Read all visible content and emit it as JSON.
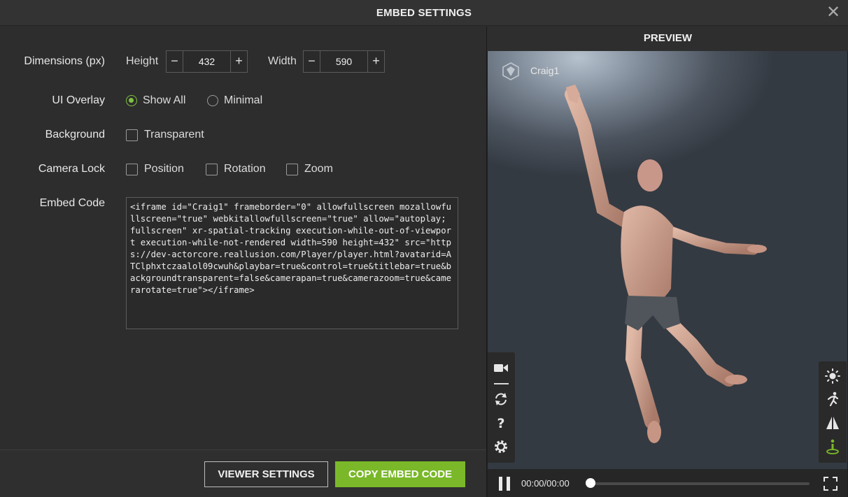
{
  "window": {
    "title": "EMBED SETTINGS",
    "close_glyph": "✕"
  },
  "form": {
    "dimensions": {
      "label": "Dimensions (px)",
      "height_label": "Height",
      "height_value": "432",
      "width_label": "Width",
      "width_value": "590",
      "minus": "−",
      "plus": "+"
    },
    "ui_overlay": {
      "label": "UI Overlay",
      "options": [
        "Show All",
        "Minimal"
      ],
      "selected": "Show All"
    },
    "background": {
      "label": "Background",
      "options": [
        "Transparent"
      ]
    },
    "camera_lock": {
      "label": "Camera Lock",
      "options": [
        "Position",
        "Rotation",
        "Zoom"
      ]
    },
    "embed_code": {
      "label": "Embed Code",
      "value": "<iframe id=\"Craig1\" frameborder=\"0\" allowfullscreen mozallowfullscreen=\"true\" webkitallowfullscreen=\"true\" allow=\"autoplay; fullscreen\" xr-spatial-tracking execution-while-out-of-viewport execution-while-not-rendered width=590 height=432\" src=\"https://dev-actorcore.reallusion.com/Player/player.html?avatarid=ATClphxtczaalol09cwuh&playbar=true&control=true&titlebar=true&backgroundtransparent=false&camerapan=true&camerazoom=true&camerarotate=true\"></iframe>"
    }
  },
  "buttons": {
    "viewer_settings": "VIEWER SETTINGS",
    "copy_embed_code": "COPY EMBED CODE"
  },
  "preview": {
    "title": "PREVIEW",
    "avatar_name": "Craig1",
    "left_tools": [
      "camera-icon",
      "rotate-icon",
      "help-icon",
      "settings-icon"
    ],
    "right_tools": [
      "light-icon",
      "motion-icon",
      "mirror-icon",
      "ground-icon"
    ],
    "player": {
      "time": "00:00/00:00",
      "progress": 0
    }
  },
  "colors": {
    "accent": "#7ab829",
    "panel": "#2d2d2d",
    "preview_bg": "#1f1f1f"
  }
}
